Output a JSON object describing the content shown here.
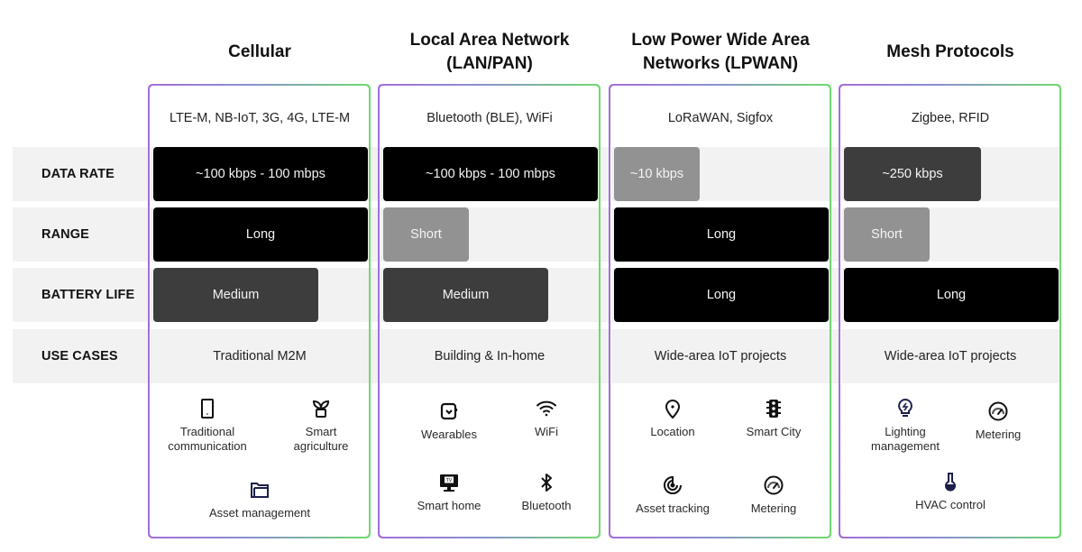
{
  "row_labels": {
    "data_rate": "DATA RATE",
    "range": "RANGE",
    "battery_life": "BATTERY LIFE",
    "use_cases": "USE CASES"
  },
  "columns": [
    {
      "title": "Cellular",
      "protocols": "LTE-M, NB-IoT, 3G, 4G, LTE-M",
      "data_rate": {
        "label": "~100 kbps - 100 mbps",
        "level": "high",
        "fill": 1.0
      },
      "range": {
        "label": "Long",
        "level": "high",
        "fill": 1.0
      },
      "battery_life": {
        "label": "Medium",
        "level": "mid",
        "fill": 0.77
      },
      "use_cases": "Traditional M2M",
      "applications": [
        {
          "label": "Traditional communication",
          "icon": "tablet-icon"
        },
        {
          "label": "Smart agriculture",
          "icon": "plant-icon"
        },
        {
          "label": "Asset management",
          "icon": "folder-icon"
        }
      ]
    },
    {
      "title": "Local Area Network (LAN/PAN)",
      "protocols": "Bluetooth (BLE), WiFi",
      "data_rate": {
        "label": "~100 kbps - 100 mbps",
        "level": "high",
        "fill": 1.0
      },
      "range": {
        "label": "Short",
        "level": "low",
        "fill": 0.4
      },
      "battery_life": {
        "label": "Medium",
        "level": "mid",
        "fill": 0.77
      },
      "use_cases": "Building & In-home",
      "applications": [
        {
          "label": "Wearables",
          "icon": "smartwatch-icon"
        },
        {
          "label": "WiFi",
          "icon": "wifi-icon"
        },
        {
          "label": "Smart home",
          "icon": "tv-icon"
        },
        {
          "label": "Bluetooth",
          "icon": "bluetooth-icon"
        }
      ]
    },
    {
      "title": "Low Power Wide Area Networks (LPWAN)",
      "protocols": "LoRaWAN, Sigfox",
      "data_rate": {
        "label": "~10 kbps",
        "level": "low",
        "fill": 0.4
      },
      "range": {
        "label": "Long",
        "level": "high",
        "fill": 1.0
      },
      "battery_life": {
        "label": "Long",
        "level": "high",
        "fill": 1.0
      },
      "use_cases": "Wide-area IoT projects",
      "applications": [
        {
          "label": "Location",
          "icon": "location-pin-icon"
        },
        {
          "label": "Smart City",
          "icon": "traffic-light-icon"
        },
        {
          "label": "Asset tracking",
          "icon": "radar-icon"
        },
        {
          "label": "Metering",
          "icon": "gauge-icon"
        }
      ]
    },
    {
      "title": "Mesh Protocols",
      "protocols": "Zigbee, RFID",
      "data_rate": {
        "label": "~250 kbps",
        "level": "mid",
        "fill": 0.64
      },
      "range": {
        "label": "Short",
        "level": "low",
        "fill": 0.4
      },
      "battery_life": {
        "label": "Long",
        "level": "high",
        "fill": 1.0
      },
      "use_cases": "Wide-area IoT projects",
      "applications": [
        {
          "label": "Lighting management",
          "icon": "lightbulb-icon"
        },
        {
          "label": "Metering",
          "icon": "gauge-icon"
        },
        {
          "label": "HVAC control",
          "icon": "thermometer-icon"
        }
      ]
    }
  ],
  "colors": {
    "level_high": "#000000",
    "level_mid": "#3d3d3d",
    "level_low": "#929292",
    "row_band": "#f2f2f2",
    "card_border_start": "#a36fd6",
    "card_border_end": "#6fda6f",
    "icon_navy": "#1c1f4a"
  }
}
